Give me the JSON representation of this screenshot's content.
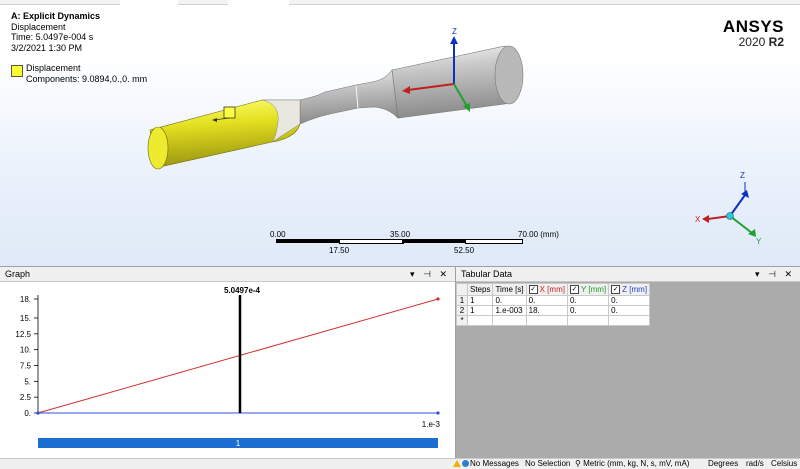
{
  "viewport": {
    "title": "A: Explicit Dynamics",
    "result_name": "Displacement",
    "time": "Time: 5.0497e-004 s",
    "date": "3/2/2021 1:30 PM",
    "legend_title": "Displacement",
    "legend_components": "Components: 9.0894,0.,0. mm",
    "brand_name": "ANSYS",
    "brand_version_year": "2020",
    "brand_version_rel": "R2",
    "triad_labels": [
      "Z",
      "X",
      "Y"
    ],
    "scale_top": [
      "0.00",
      "35.00",
      "70.00 (mm)"
    ],
    "scale_bottom": [
      "17.50",
      "52.50"
    ],
    "colors": {
      "part": "#ffff30",
      "background": "#dfe9f7"
    }
  },
  "graph": {
    "title": "Graph",
    "header_controls": [
      "▾",
      "⊣",
      "✕"
    ],
    "cursor_label": "5.0497e-4",
    "step_label": "1",
    "x_end_label": "1.e-3"
  },
  "chart_data": {
    "type": "line",
    "x": [
      0,
      0.001
    ],
    "series": [
      {
        "values": [
          0,
          18
        ],
        "color": "#d03030"
      },
      {
        "values": [
          0,
          0
        ],
        "color": "#3050e0"
      }
    ],
    "ylim": [
      0,
      18
    ],
    "yticks": [
      "0.",
      "2.5",
      "5.",
      "7.5",
      "10.",
      "12.5",
      "15.",
      "18."
    ],
    "cursor_x": 0.00050497,
    "xlim": [
      0,
      0.001
    ]
  },
  "tabular": {
    "title": "Tabular Data",
    "header_controls": [
      "▾",
      "⊣",
      "✕"
    ],
    "columns": [
      "Steps",
      "Time [s]",
      "X [mm]",
      "Y [mm]",
      "Z [mm]"
    ],
    "column_colors": [
      "#000000",
      "#000000",
      "#d02020",
      "#20a020",
      "#2040d0"
    ],
    "rows": [
      {
        "rn": "1",
        "cells": [
          "1",
          "0.",
          "0.",
          "0.",
          "0."
        ]
      },
      {
        "rn": "2",
        "cells": [
          "1",
          "1.e-003",
          "18.",
          "0.",
          "0."
        ]
      },
      {
        "rn": "*",
        "cells": [
          "",
          "",
          "",
          "",
          ""
        ]
      }
    ]
  },
  "statusbar": {
    "messages": "No Messages",
    "selection": "No Selection",
    "units": "Metric (mm, kg, N, s, mV, mA)",
    "angle": "Degrees",
    "rotation": "rad/s",
    "temperature": "Celsius"
  }
}
